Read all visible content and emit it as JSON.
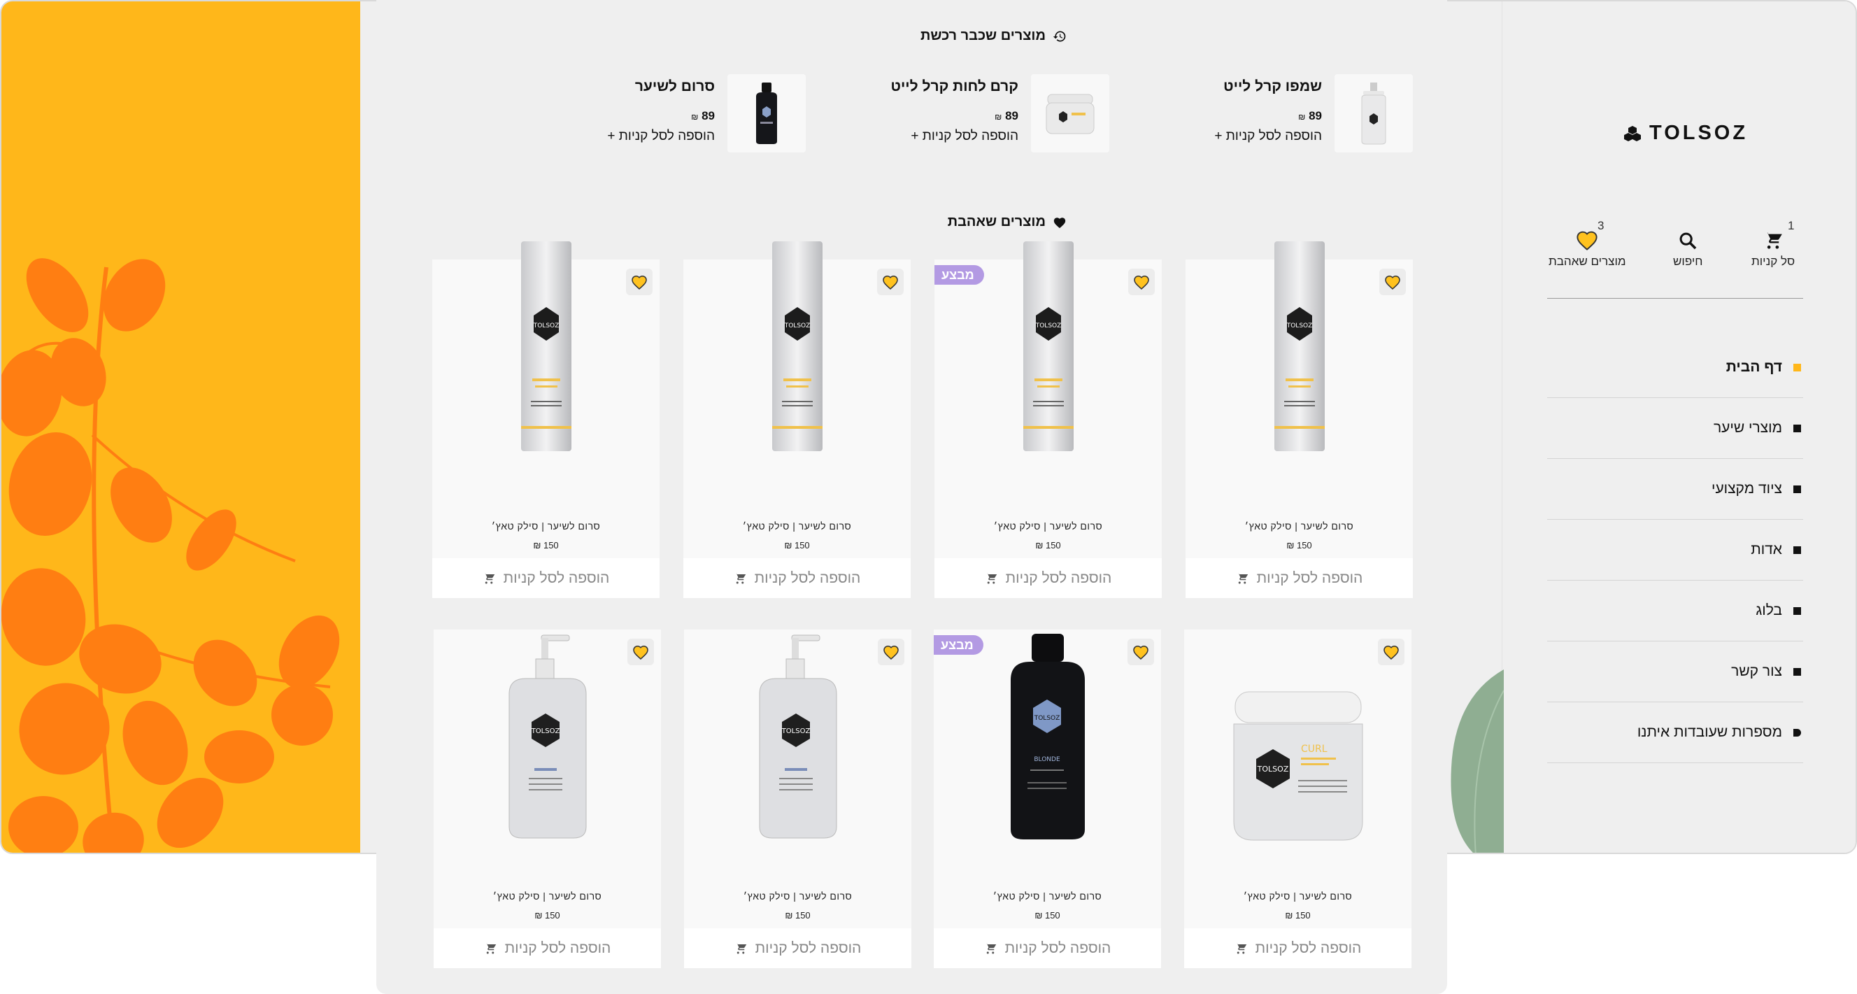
{
  "brand": {
    "logo_text": "TOLSOZ"
  },
  "header_icons": {
    "cart": {
      "label": "סל קניות",
      "count": "1"
    },
    "search": {
      "label": "חיפוש"
    },
    "favorites": {
      "label": "מוצרים שאהבת",
      "count": "3"
    }
  },
  "nav": {
    "items": [
      {
        "label": "דף הבית",
        "active": true
      },
      {
        "label": "מוצרי שיער"
      },
      {
        "label": "ציוד מקצועי"
      },
      {
        "label": "אדות"
      },
      {
        "label": "בלוג"
      },
      {
        "label": "צור קשר"
      },
      {
        "label": "מספרות שעובדות איתנו"
      }
    ]
  },
  "recent": {
    "title": "מוצרים שכבר רכשת",
    "items": [
      {
        "name": "שמפו קרל לייט",
        "price": "89",
        "currency": "₪",
        "add": "הוספה לסל קניות +"
      },
      {
        "name": "קרם לחות קרל לייט",
        "price": "89",
        "currency": "₪",
        "add": "הוספה לסל קניות +"
      },
      {
        "name": "סרום לשיער",
        "price": "89",
        "currency": "₪",
        "add": "הוספה לסל קניות +"
      }
    ]
  },
  "favorites": {
    "title": "מוצרים שאהבת",
    "products": [
      {
        "name": "סרום לשיער | סילק טאץ׳",
        "price": "150 ₪",
        "add": "הוספה לסל קניות",
        "badge": "",
        "type": "spray"
      },
      {
        "name": "סרום לשיער | סילק טאץ׳",
        "price": "150 ₪",
        "add": "הוספה לסל קניות",
        "badge": "מבצע",
        "type": "spray"
      },
      {
        "name": "סרום לשיער | סילק טאץ׳",
        "price": "150 ₪",
        "add": "הוספה לסל קניות",
        "badge": "",
        "type": "spray"
      },
      {
        "name": "סרום לשיער | סילק טאץ׳",
        "price": "150 ₪",
        "add": "הוספה לסל קניות",
        "badge": "",
        "type": "spray"
      },
      {
        "name": "סרום לשיער | סילק טאץ׳",
        "price": "150 ₪",
        "add": "הוספה לסל קניות",
        "badge": "",
        "type": "jar"
      },
      {
        "name": "סרום לשיער | סילק טאץ׳",
        "price": "150 ₪",
        "add": "הוספה לסל קניות",
        "badge": "מבצע",
        "type": "black-bottle"
      },
      {
        "name": "סרום לשיער | סילק טאץ׳",
        "price": "150 ₪",
        "add": "הוספה לסל קניות",
        "badge": "",
        "type": "pump"
      },
      {
        "name": "סרום לשיער | סילק טאץ׳",
        "price": "150 ₪",
        "add": "הוספה לסל קניות",
        "badge": "",
        "type": "pump"
      }
    ]
  },
  "colors": {
    "accent": "#ffb71a",
    "badge": "#b39ae3",
    "leaf": "#ff6a1a"
  }
}
